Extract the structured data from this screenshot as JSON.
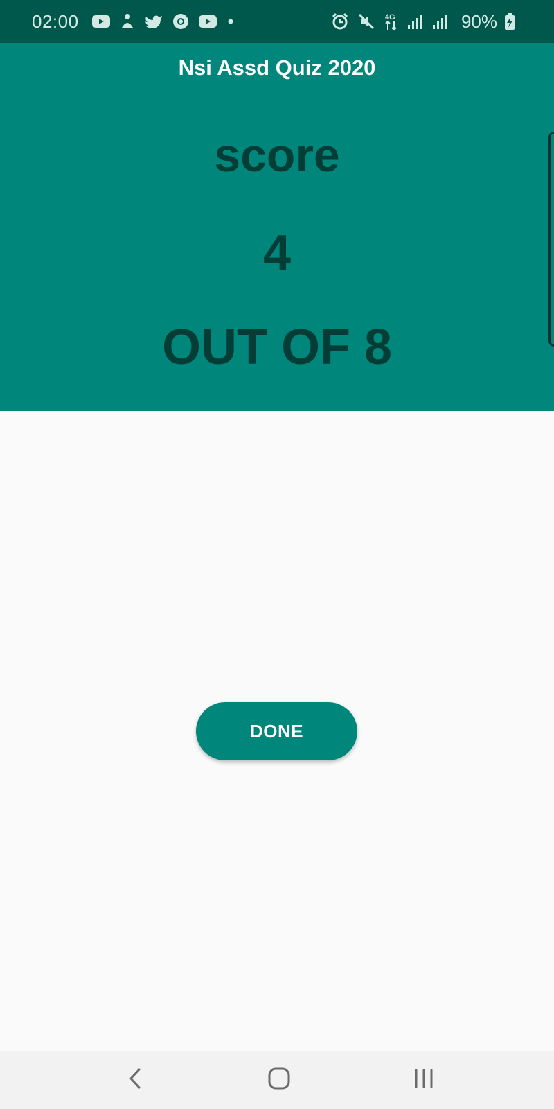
{
  "status_bar": {
    "time": "02:00",
    "left_icons": [
      "youtube-icon",
      "notification-app-icon",
      "twitter-icon",
      "chrome-icon",
      "youtube-icon",
      "more-dot-icon"
    ],
    "right_icons": [
      "alarm-icon",
      "mute-icon",
      "network-4g-icon",
      "signal-icon",
      "signal-icon",
      "battery-charging-icon"
    ],
    "battery_text": "90%"
  },
  "app": {
    "title": "Nsi Assd Quiz 2020"
  },
  "score": {
    "label": "score",
    "value": "4",
    "total": "OUT OF 8"
  },
  "actions": {
    "done_label": "DONE"
  },
  "nav_bar": {
    "icons": [
      "back-icon",
      "home-icon",
      "recent-apps-icon"
    ]
  },
  "colors": {
    "status_bar": "#00574b",
    "primary": "#00867a",
    "score_text": "#043d36",
    "background": "#fafafa",
    "nav_bar": "#f2f2f2"
  }
}
